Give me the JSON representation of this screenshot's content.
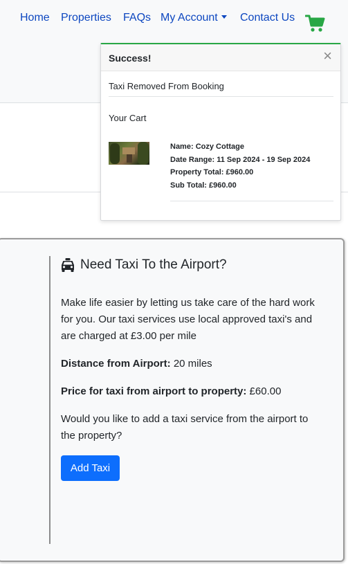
{
  "nav": {
    "home": "Home",
    "properties": "Properties",
    "faqs": "FAQs",
    "my_account": "My Account",
    "contact_us": "Contact Us",
    "cart_icon": "shopping-cart-icon",
    "link_color": "#0d47c0",
    "cart_color": "#28a745"
  },
  "toast": {
    "title": "Success!",
    "close": "×",
    "message": "Taxi Removed From Booking",
    "cart_title": "Your Cart",
    "accent_color": "#28a745",
    "item": {
      "name_label": "Name:",
      "name": "Cozy Cottage",
      "date_label": "Date Range:",
      "date_range": "11 Sep 2024 - 19 Sep 2024",
      "property_total_label": "Property Total:",
      "property_total": "£960.00",
      "sub_total_label": "Sub Total:",
      "sub_total": "£960.00"
    }
  },
  "taxi": {
    "icon": "taxi-icon",
    "heading": "Need Taxi To the Airport?",
    "description": "Make life easier by letting us take care of the hard work for you. Our taxi services use local approved taxi's and are charged at £3.00 per mile",
    "distance_label": "Distance from Airport:",
    "distance_value": "20 miles",
    "price_label": "Price for taxi from airport to property:",
    "price_value": "£60.00",
    "question": "Would you like to add a taxi service from the airport to the property?",
    "button_label": "Add Taxi",
    "button_color": "#0d6efd"
  }
}
